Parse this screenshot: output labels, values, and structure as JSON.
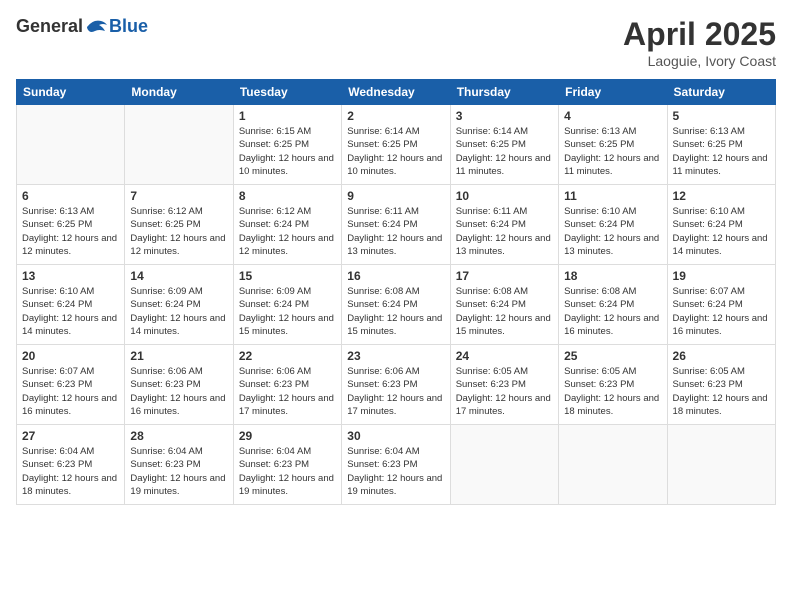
{
  "logo": {
    "general": "General",
    "blue": "Blue"
  },
  "header": {
    "month_year": "April 2025",
    "location": "Laoguie, Ivory Coast"
  },
  "weekdays": [
    "Sunday",
    "Monday",
    "Tuesday",
    "Wednesday",
    "Thursday",
    "Friday",
    "Saturday"
  ],
  "weeks": [
    [
      {
        "day": "",
        "info": ""
      },
      {
        "day": "",
        "info": ""
      },
      {
        "day": "1",
        "info": "Sunrise: 6:15 AM\nSunset: 6:25 PM\nDaylight: 12 hours and 10 minutes."
      },
      {
        "day": "2",
        "info": "Sunrise: 6:14 AM\nSunset: 6:25 PM\nDaylight: 12 hours and 10 minutes."
      },
      {
        "day": "3",
        "info": "Sunrise: 6:14 AM\nSunset: 6:25 PM\nDaylight: 12 hours and 11 minutes."
      },
      {
        "day": "4",
        "info": "Sunrise: 6:13 AM\nSunset: 6:25 PM\nDaylight: 12 hours and 11 minutes."
      },
      {
        "day": "5",
        "info": "Sunrise: 6:13 AM\nSunset: 6:25 PM\nDaylight: 12 hours and 11 minutes."
      }
    ],
    [
      {
        "day": "6",
        "info": "Sunrise: 6:13 AM\nSunset: 6:25 PM\nDaylight: 12 hours and 12 minutes."
      },
      {
        "day": "7",
        "info": "Sunrise: 6:12 AM\nSunset: 6:25 PM\nDaylight: 12 hours and 12 minutes."
      },
      {
        "day": "8",
        "info": "Sunrise: 6:12 AM\nSunset: 6:24 PM\nDaylight: 12 hours and 12 minutes."
      },
      {
        "day": "9",
        "info": "Sunrise: 6:11 AM\nSunset: 6:24 PM\nDaylight: 12 hours and 13 minutes."
      },
      {
        "day": "10",
        "info": "Sunrise: 6:11 AM\nSunset: 6:24 PM\nDaylight: 12 hours and 13 minutes."
      },
      {
        "day": "11",
        "info": "Sunrise: 6:10 AM\nSunset: 6:24 PM\nDaylight: 12 hours and 13 minutes."
      },
      {
        "day": "12",
        "info": "Sunrise: 6:10 AM\nSunset: 6:24 PM\nDaylight: 12 hours and 14 minutes."
      }
    ],
    [
      {
        "day": "13",
        "info": "Sunrise: 6:10 AM\nSunset: 6:24 PM\nDaylight: 12 hours and 14 minutes."
      },
      {
        "day": "14",
        "info": "Sunrise: 6:09 AM\nSunset: 6:24 PM\nDaylight: 12 hours and 14 minutes."
      },
      {
        "day": "15",
        "info": "Sunrise: 6:09 AM\nSunset: 6:24 PM\nDaylight: 12 hours and 15 minutes."
      },
      {
        "day": "16",
        "info": "Sunrise: 6:08 AM\nSunset: 6:24 PM\nDaylight: 12 hours and 15 minutes."
      },
      {
        "day": "17",
        "info": "Sunrise: 6:08 AM\nSunset: 6:24 PM\nDaylight: 12 hours and 15 minutes."
      },
      {
        "day": "18",
        "info": "Sunrise: 6:08 AM\nSunset: 6:24 PM\nDaylight: 12 hours and 16 minutes."
      },
      {
        "day": "19",
        "info": "Sunrise: 6:07 AM\nSunset: 6:24 PM\nDaylight: 12 hours and 16 minutes."
      }
    ],
    [
      {
        "day": "20",
        "info": "Sunrise: 6:07 AM\nSunset: 6:23 PM\nDaylight: 12 hours and 16 minutes."
      },
      {
        "day": "21",
        "info": "Sunrise: 6:06 AM\nSunset: 6:23 PM\nDaylight: 12 hours and 16 minutes."
      },
      {
        "day": "22",
        "info": "Sunrise: 6:06 AM\nSunset: 6:23 PM\nDaylight: 12 hours and 17 minutes."
      },
      {
        "day": "23",
        "info": "Sunrise: 6:06 AM\nSunset: 6:23 PM\nDaylight: 12 hours and 17 minutes."
      },
      {
        "day": "24",
        "info": "Sunrise: 6:05 AM\nSunset: 6:23 PM\nDaylight: 12 hours and 17 minutes."
      },
      {
        "day": "25",
        "info": "Sunrise: 6:05 AM\nSunset: 6:23 PM\nDaylight: 12 hours and 18 minutes."
      },
      {
        "day": "26",
        "info": "Sunrise: 6:05 AM\nSunset: 6:23 PM\nDaylight: 12 hours and 18 minutes."
      }
    ],
    [
      {
        "day": "27",
        "info": "Sunrise: 6:04 AM\nSunset: 6:23 PM\nDaylight: 12 hours and 18 minutes."
      },
      {
        "day": "28",
        "info": "Sunrise: 6:04 AM\nSunset: 6:23 PM\nDaylight: 12 hours and 19 minutes."
      },
      {
        "day": "29",
        "info": "Sunrise: 6:04 AM\nSunset: 6:23 PM\nDaylight: 12 hours and 19 minutes."
      },
      {
        "day": "30",
        "info": "Sunrise: 6:04 AM\nSunset: 6:23 PM\nDaylight: 12 hours and 19 minutes."
      },
      {
        "day": "",
        "info": ""
      },
      {
        "day": "",
        "info": ""
      },
      {
        "day": "",
        "info": ""
      }
    ]
  ]
}
